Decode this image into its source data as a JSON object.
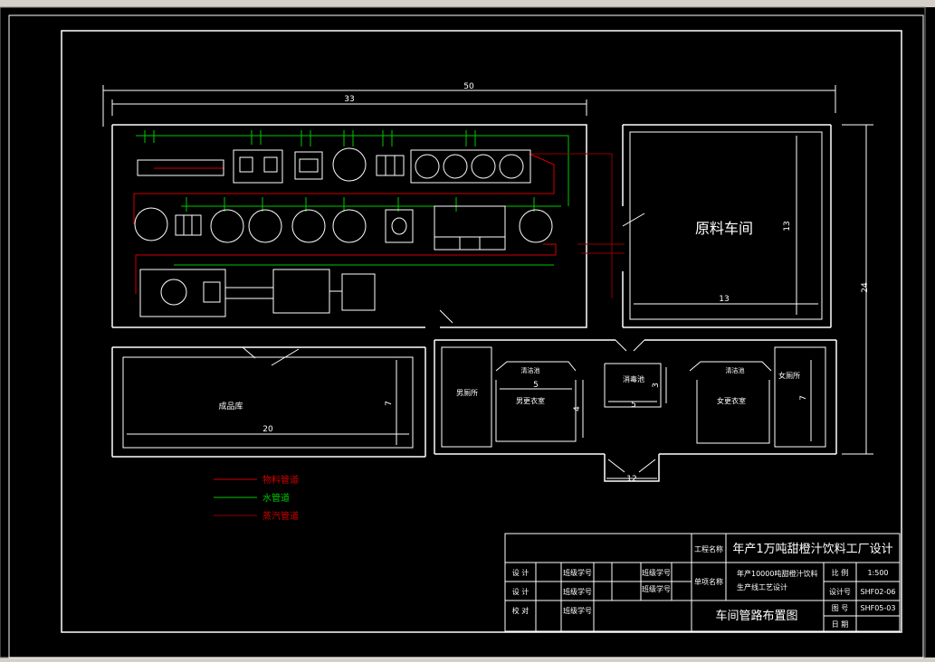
{
  "colors": {
    "background": "#000000",
    "outline": "#ffffff",
    "water_pipe": "#00c800",
    "material_pipe": "#d00000",
    "steam_pipe": "#900000"
  },
  "dimensions": {
    "overall_width": "50",
    "production_width": "33",
    "overall_height": "24",
    "raw_room_width": "13",
    "raw_room_height": "13",
    "warehouse_width": "20",
    "warehouse_height": "7",
    "dressing_width": "5",
    "dressing_height": "4",
    "disinfect_width": "5",
    "disinfect_height": "3",
    "entrance_width": "12",
    "right_height": "7"
  },
  "rooms": {
    "raw_material": "原料车间",
    "warehouse": "成品库",
    "male_toilet": "男厕所",
    "female_toilet": "女厕所",
    "male_dressing": "男更衣室",
    "female_dressing": "女更衣室",
    "disinfect": "消毒池",
    "clean_left": "清洁池",
    "clean_right": "清洁池"
  },
  "legend": [
    {
      "label": "物料管道",
      "color": "#d00000"
    },
    {
      "label": "水管道",
      "color": "#00c800"
    },
    {
      "label": "蒸汽管道",
      "color": "#900000"
    }
  ],
  "title_block": {
    "project_label": "工程名称",
    "project_name": "年产1万吨甜橙汁饮料工厂设计",
    "unit_label": "单项名称",
    "unit_name_1": "年产10000吨甜橙汁饮料",
    "unit_name_2": "生产线工艺设计",
    "roles": [
      "设  计",
      "设  计",
      "校  对"
    ],
    "class_no": [
      "班级学号",
      "班级学号",
      "班级学号"
    ],
    "class_no_2": [
      "班级学号",
      "班级学号"
    ],
    "scale_label": "比  例",
    "scale_value": "1:500",
    "design_label": "设计号",
    "design_value": "SHF02-06",
    "drawing_label": "图  号",
    "drawing_value": "SHF05-03",
    "date_label": "日  期",
    "drawing_title": "车间管路布置图"
  }
}
